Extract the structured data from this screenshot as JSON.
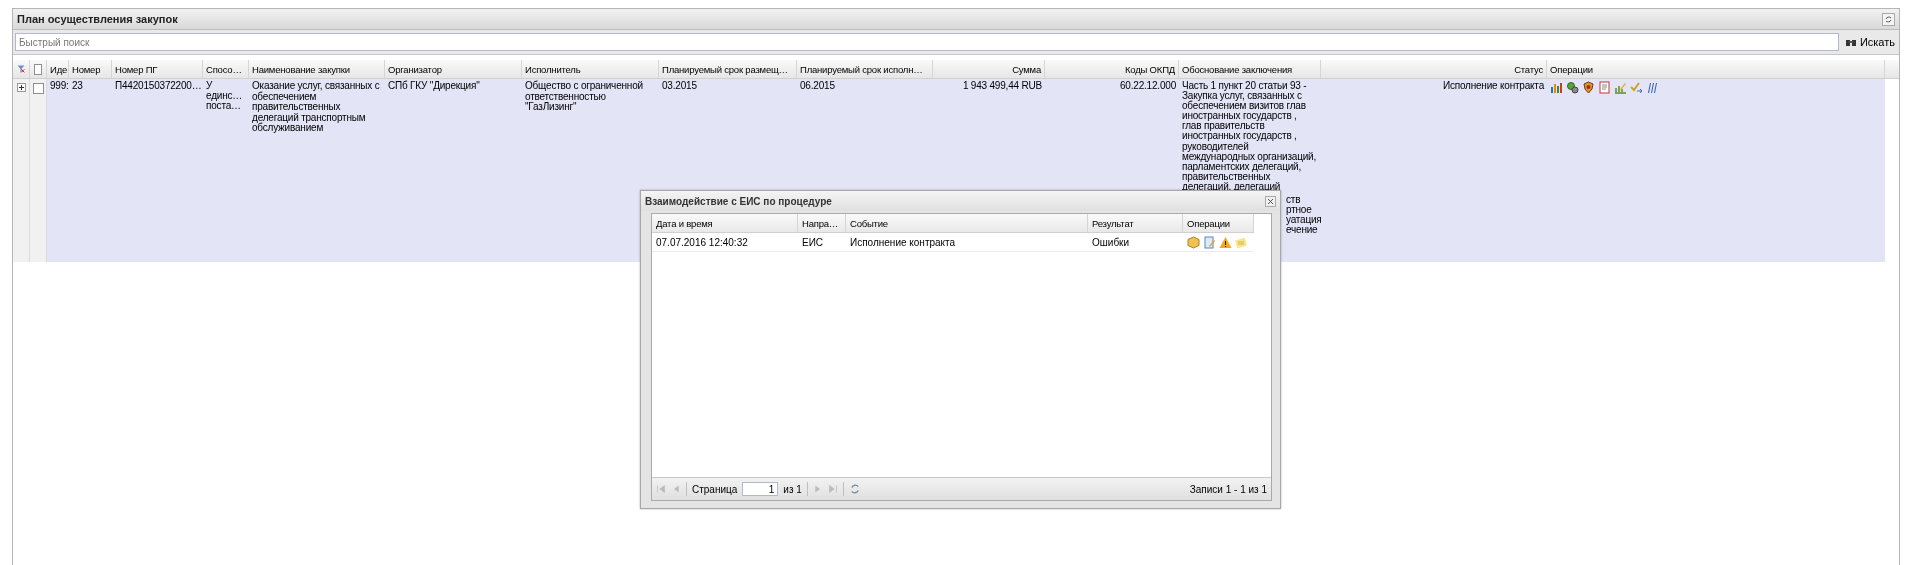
{
  "panel": {
    "title": "План осуществления закупок"
  },
  "search": {
    "placeholder": "Быстрый поиск",
    "button": "Искать"
  },
  "table": {
    "select_all_checked": false,
    "columns": [
      "Иде",
      "Номер",
      "Номер ПГ",
      "Спосо…",
      "Наименование закупки",
      "Организатор",
      "Исполнитель",
      "Планируемый срок размещ…",
      "Планируемый срок исполн…",
      "Сумма",
      "Коды ОКПД",
      "Обоснование заключения",
      "Статус",
      "Операции"
    ],
    "rows": [
      {
        "expanded": false,
        "checked": false,
        "cells": [
          {
            "kind": "text",
            "text": "999:"
          },
          {
            "kind": "text",
            "text": "23"
          },
          {
            "kind": "text",
            "text": "П4420150372200…"
          },
          {
            "kind": "lines",
            "lines": [
              "У",
              "единс…",
              "поста…"
            ]
          },
          {
            "kind": "text",
            "text": "Оказание услуг, связанных с обеспечением правительственных делегаций транспортным обслуживанием"
          },
          {
            "kind": "text",
            "text": "СПб ГКУ \"Дирекция\""
          },
          {
            "kind": "text",
            "text": "Общество с ограниченной ответственностью \"ГазЛизинг\""
          },
          {
            "kind": "text",
            "text": "03.2015"
          },
          {
            "kind": "text",
            "text": "06.2015"
          },
          {
            "kind": "text",
            "text": "1 943 499,44 RUB"
          },
          {
            "kind": "text",
            "text": "60.22.12.000"
          },
          {
            "kind": "lines",
            "lines": [
              "Часть 1 пункт 20 статьи 93 -",
              "Закупка услуг, связанных с",
              "обеспечением визитов глав",
              "иностранных государств ,",
              "глав правительств",
              "иностранных государств ,",
              "руководителей",
              "международных организаций,",
              "парламентских делегаций,",
              "правительственных",
              "делегаций, делегаций"
            ],
            "lines_past_dialog": [
              "ств",
              "ртное",
              "уатация",
              "ечение"
            ]
          },
          {
            "kind": "text",
            "text": "Исполнение контракта"
          },
          {
            "kind": "operations"
          }
        ]
      }
    ]
  },
  "dialog": {
    "title": "Взаимодействие с ЕИС по процедуре",
    "columns": [
      "Дата и время",
      "Напра…",
      "Событие",
      "Результат",
      "Операции"
    ],
    "rows": [
      {
        "cells": [
          "07.07.2016 12:40:32",
          "ЕИС",
          "Исполнение контракта",
          "Ошибки"
        ]
      }
    ],
    "pager": {
      "page_label": "Страница",
      "page": "1",
      "of": "из 1",
      "summary": "Записи 1 - 1 из 1"
    }
  }
}
